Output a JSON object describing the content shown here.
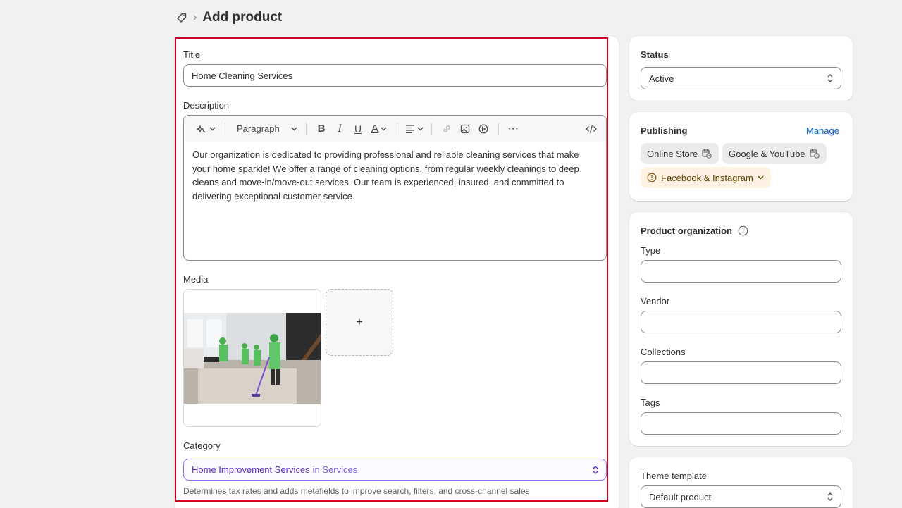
{
  "header": {
    "title": "Add product",
    "icon": "tag-icon"
  },
  "product": {
    "title_label": "Title",
    "title_value": "Home Cleaning Services",
    "description_label": "Description",
    "toolbar": {
      "paragraph_label": "Paragraph"
    },
    "description_text": "Our organization is dedicated to providing professional and reliable cleaning services that make your home sparkle! We offer a range of cleaning options, from regular weekly cleanings to deep cleans and move-in/move-out services. Our team is experienced, insured, and committed to delivering exceptional customer service.",
    "media_label": "Media",
    "add_media_symbol": "+",
    "category_label": "Category",
    "category_value": "Home Improvement Services",
    "category_parent": "in Services",
    "category_help": "Determines tax rates and adds metafields to improve search, filters, and cross-channel sales"
  },
  "status": {
    "label": "Status",
    "value": "Active"
  },
  "publishing": {
    "label": "Publishing",
    "manage_label": "Manage",
    "channels": [
      {
        "name": "Online Store"
      },
      {
        "name": "Google & YouTube"
      },
      {
        "name": "Facebook & Instagram"
      }
    ]
  },
  "organization": {
    "label": "Product organization",
    "type_label": "Type",
    "vendor_label": "Vendor",
    "collections_label": "Collections",
    "tags_label": "Tags"
  },
  "theme": {
    "label": "Theme template",
    "value": "Default product"
  },
  "colors": {
    "highlight": "#d0021b",
    "link": "#005bd3",
    "category": "#5c2ec8"
  }
}
